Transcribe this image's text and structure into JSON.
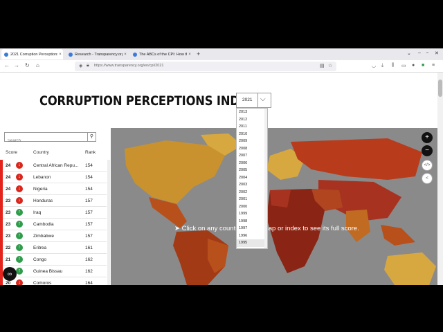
{
  "browser": {
    "tabs": [
      {
        "label": "2021 Corruption Perceptions In",
        "active": true
      },
      {
        "label": "Research - Transparency.org",
        "active": false
      },
      {
        "label": "The ABCs of the CPI: How the C",
        "active": false
      }
    ],
    "url": "https://www.transparency.org/en/cpi/2021",
    "close_glyph": "×",
    "new_tab_glyph": "+"
  },
  "page": {
    "title": "CORRUPTION PERCEPTIONS INDEX",
    "year_selected": "2021",
    "year_options": [
      "2013",
      "2012",
      "2011",
      "2010",
      "2009",
      "2008",
      "2007",
      "2006",
      "2005",
      "2004",
      "2003",
      "2002",
      "2001",
      "2000",
      "1999",
      "1998",
      "1997",
      "1996",
      "1995"
    ],
    "search_placeholder": "Search",
    "columns": {
      "score": "Score",
      "country": "Country",
      "rank": "Rank"
    },
    "rows": [
      {
        "score": "24",
        "trend": "down",
        "country": "Central African Repu...",
        "rank": "154"
      },
      {
        "score": "24",
        "trend": "down",
        "country": "Lebanon",
        "rank": "154"
      },
      {
        "score": "24",
        "trend": "down",
        "country": "Nigeria",
        "rank": "154"
      },
      {
        "score": "23",
        "trend": "down",
        "country": "Honduras",
        "rank": "157"
      },
      {
        "score": "23",
        "trend": "up",
        "country": "Iraq",
        "rank": "157"
      },
      {
        "score": "23",
        "trend": "up",
        "country": "Cambodia",
        "rank": "157"
      },
      {
        "score": "23",
        "trend": "up",
        "country": "Zimbabwe",
        "rank": "157"
      },
      {
        "score": "22",
        "trend": "up",
        "country": "Eritrea",
        "rank": "161"
      },
      {
        "score": "21",
        "trend": "up",
        "country": "Congo",
        "rank": "162"
      },
      {
        "score": "21",
        "trend": "up",
        "country": "Guinea Bissau",
        "rank": "162"
      },
      {
        "score": "20",
        "trend": "down",
        "country": "Comoros",
        "rank": "164"
      }
    ],
    "map_tip": "Click on any country on the map or index to see its full score.",
    "zoom_in": "+",
    "zoom_out": "−",
    "embed_label": "</>",
    "share_glyph": "<"
  },
  "colors": {
    "red_stripe": "#e4241c",
    "trend_down": "#d9261c",
    "trend_up": "#2e9c4a",
    "map_bg": "#8a8a8a"
  }
}
